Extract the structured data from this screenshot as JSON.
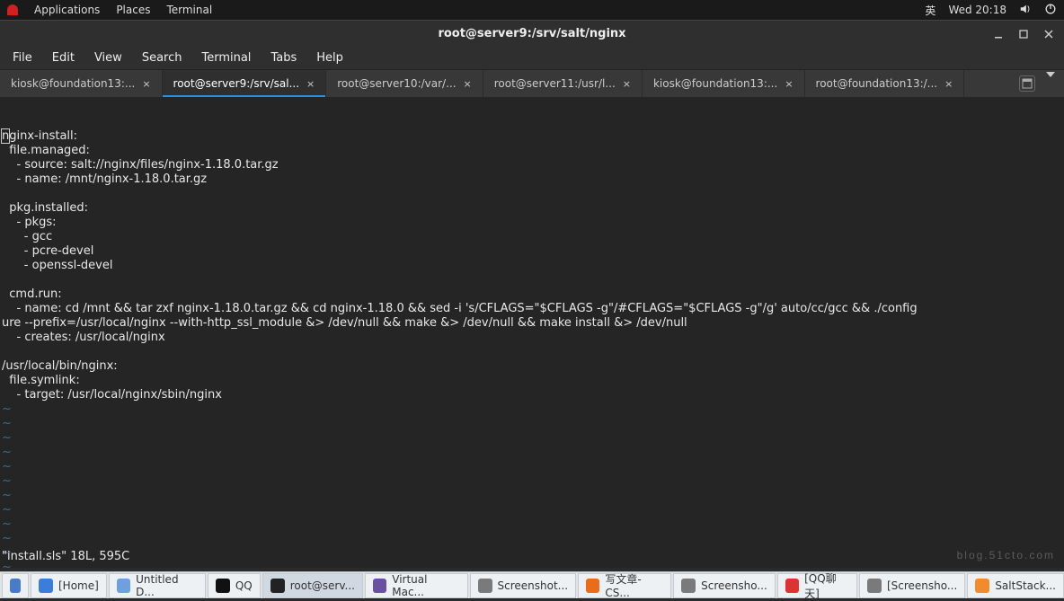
{
  "topbar": {
    "menus": [
      "Applications",
      "Places",
      "Terminal"
    ],
    "ime": "英",
    "clock": "Wed 20:18"
  },
  "window": {
    "title": "root@server9:/srv/salt/nginx"
  },
  "menubar": [
    "File",
    "Edit",
    "View",
    "Search",
    "Terminal",
    "Tabs",
    "Help"
  ],
  "tabs": [
    {
      "label": "kiosk@foundation13:...",
      "active": false
    },
    {
      "label": "root@server9:/srv/sal...",
      "active": true
    },
    {
      "label": "root@server10:/var/...",
      "active": false
    },
    {
      "label": "root@server11:/usr/l...",
      "active": false
    },
    {
      "label": "kiosk@foundation13:...",
      "active": false
    },
    {
      "label": "root@foundation13:/...",
      "active": false
    }
  ],
  "editor": {
    "lines": [
      "nginx-install:",
      "  file.managed:",
      "    - source: salt://nginx/files/nginx-1.18.0.tar.gz",
      "    - name: /mnt/nginx-1.18.0.tar.gz",
      "",
      "  pkg.installed:",
      "    - pkgs:",
      "      - gcc",
      "      - pcre-devel",
      "      - openssl-devel",
      "",
      "  cmd.run:",
      "    - name: cd /mnt && tar zxf nginx-1.18.0.tar.gz && cd nginx-1.18.0 && sed -i 's/CFLAGS=\"$CFLAGS -g\"/#CFLAGS=\"$CFLAGS -g\"/g' auto/cc/gcc && ./config",
      "ure --prefix=/usr/local/nginx --with-http_ssl_module &> /dev/null && make &> /dev/null && make install &> /dev/null",
      "    - creates: /usr/local/nginx",
      "",
      "/usr/local/bin/nginx:",
      "  file.symlink:",
      "    - target: /usr/local/nginx/sbin/nginx"
    ],
    "tilde_rows": 12,
    "status_left": "\"install.sls\" 18L, 595C",
    "status_right": "",
    "cursor_char": "n"
  },
  "watermark": "blog.51cto.com",
  "taskbar": [
    {
      "icon": "#3b7dd8",
      "label": "[Home]"
    },
    {
      "icon": "#6ea0dd",
      "label": "Untitled D..."
    },
    {
      "icon": "#111",
      "label": "QQ"
    },
    {
      "icon": "#222",
      "label": "root@serv...",
      "active": true
    },
    {
      "icon": "#6b4fa0",
      "label": "Virtual Mac..."
    },
    {
      "icon": "#7a7a7a",
      "label": "Screenshot..."
    },
    {
      "icon": "#e86c1a",
      "label": "写文章-CS..."
    },
    {
      "icon": "#7a7a7a",
      "label": "Screensho..."
    },
    {
      "icon": "#d33",
      "label": "[QQ聊天]"
    },
    {
      "icon": "#7a7a7a",
      "label": "[Screensho..."
    },
    {
      "icon": "#f08c2e",
      "label": "SaltStack..."
    }
  ]
}
